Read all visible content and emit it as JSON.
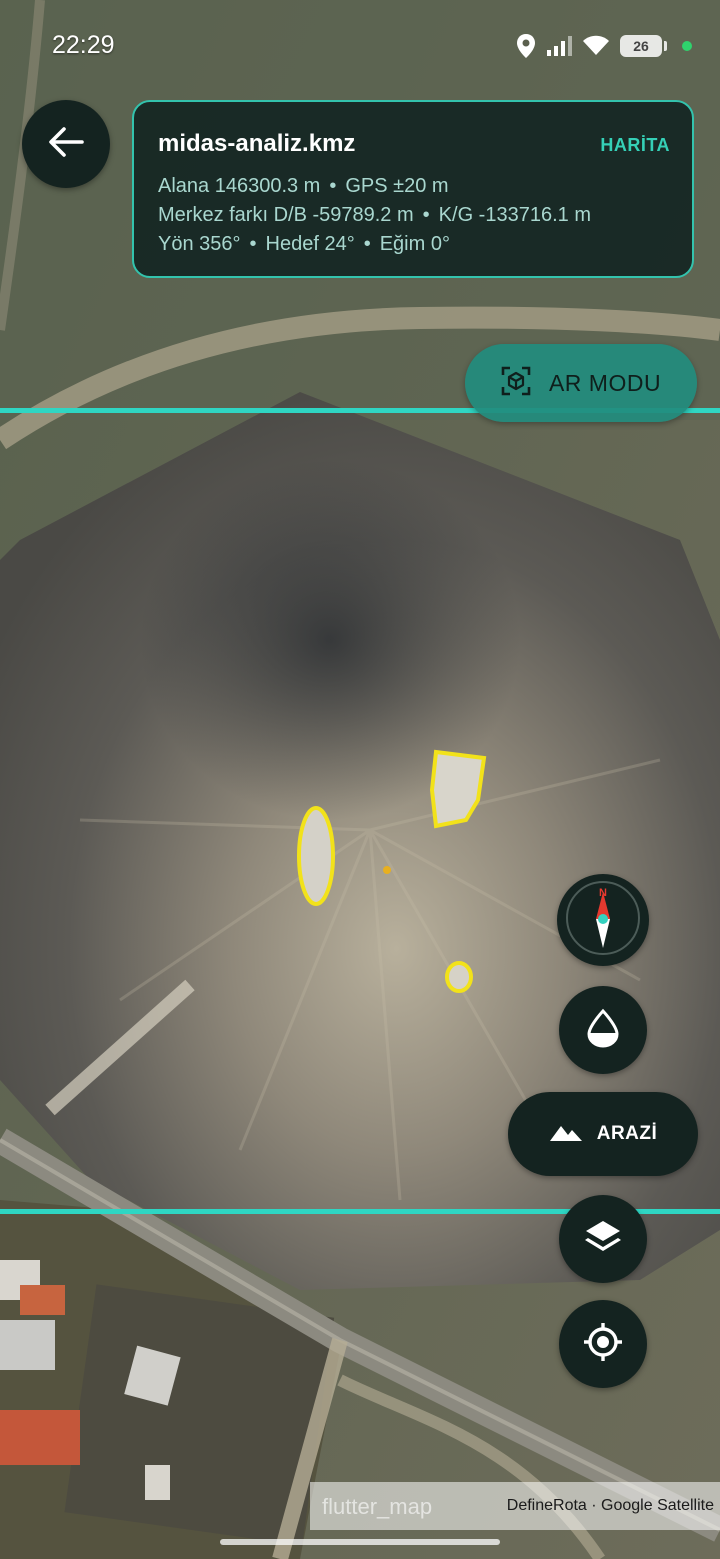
{
  "status_bar": {
    "time": "22:29",
    "battery": "26"
  },
  "header": {
    "file_name": "midas-analiz.kmz",
    "mode_label": "HARİTA",
    "line1": [
      "Alana 146300.3 m",
      "GPS ±20 m"
    ],
    "line2": [
      "Merkez farkı D/B -59789.2 m",
      "K/G -133716.1 m"
    ],
    "line3": [
      "Yön 356°",
      "Hedef 24°",
      "Eğim 0°"
    ],
    "separator": "•"
  },
  "ar_button": {
    "label": "AR MODU",
    "icon": "ar-cube-icon"
  },
  "controls": {
    "terrain_label": "ARAZİ",
    "compass_north": "N"
  },
  "attribution": {
    "ghost": "flutter_map",
    "text": "DefineRota · Google Satellite"
  },
  "colors": {
    "accent": "#33c3ad",
    "panel": "#142320",
    "highlight": "#f2e21a"
  }
}
